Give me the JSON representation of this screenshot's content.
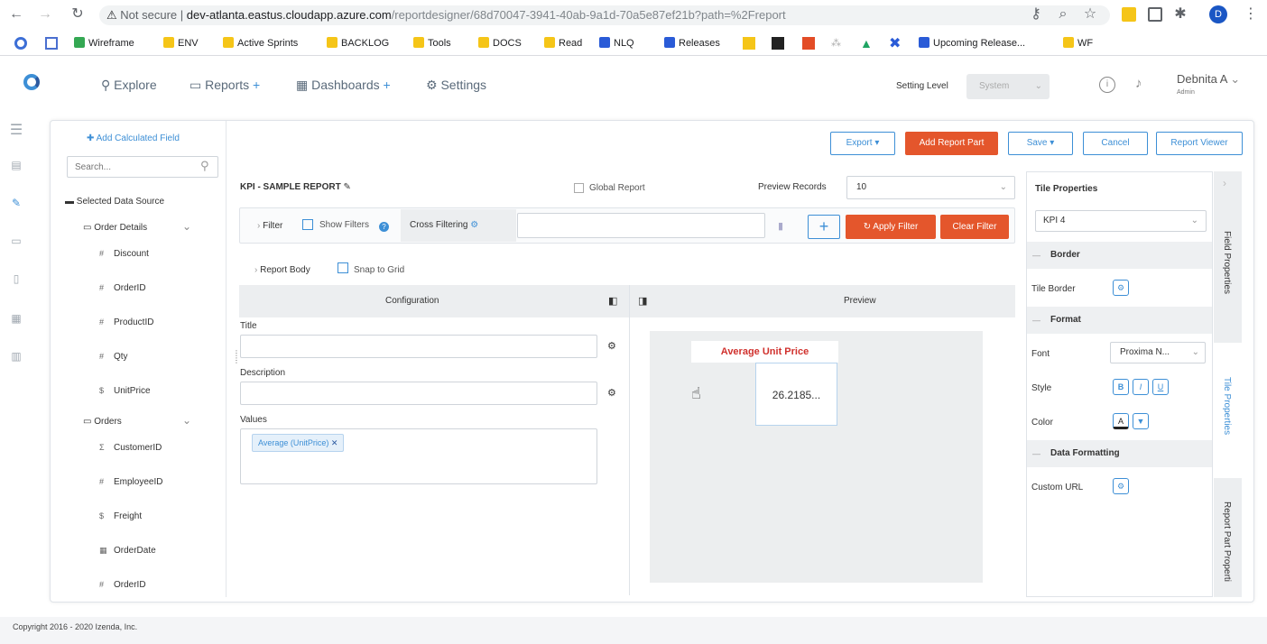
{
  "browser": {
    "not_secure": "Not secure",
    "url_host": "dev-atlanta.eastus.cloudapp.azure.com",
    "url_path": "/reportdesigner/68d70047-3941-40ab-9a1d-70a5e87ef21b?path=%2Freport",
    "profile_initial": "D",
    "bookmarks": [
      "Wireframe",
      "ENV",
      "Active Sprints",
      "BACKLOG",
      "Tools",
      "DOCS",
      "Read",
      "NLQ",
      "Releases",
      "Upcoming Release...",
      "WF"
    ]
  },
  "header": {
    "explore": "Explore",
    "reports": "Reports",
    "dashboards": "Dashboards",
    "settings": "Settings",
    "setting_level_label": "Setting Level",
    "setting_level_value": "System",
    "user_name": "Debnita A",
    "user_role": "Admin"
  },
  "toolbar": {
    "export": "Export",
    "add_report_part": "Add Report Part",
    "save": "Save",
    "cancel": "Cancel",
    "report_viewer": "Report Viewer"
  },
  "datasource": {
    "add_calculated_field": "Add Calculated Field",
    "search_placeholder": "Search...",
    "selected_label": "Selected Data Source",
    "groups": [
      {
        "name": "Order Details",
        "fields": [
          {
            "name": "Discount",
            "type": "#"
          },
          {
            "name": "OrderID",
            "type": "#"
          },
          {
            "name": "ProductID",
            "type": "#"
          },
          {
            "name": "Qty",
            "type": "#"
          },
          {
            "name": "UnitPrice",
            "type": "$"
          }
        ]
      },
      {
        "name": "Orders",
        "fields": [
          {
            "name": "CustomerID",
            "type": "Σ"
          },
          {
            "name": "EmployeeID",
            "type": "#"
          },
          {
            "name": "Freight",
            "type": "$"
          },
          {
            "name": "OrderDate",
            "type": "▦"
          },
          {
            "name": "OrderID",
            "type": "#"
          }
        ]
      }
    ]
  },
  "report": {
    "title": "KPI - SAMPLE REPORT",
    "global_report": "Global Report",
    "preview_records_label": "Preview Records",
    "preview_records_value": "10",
    "filter": "Filter",
    "show_filters": "Show Filters",
    "cross_filtering": "Cross Filtering",
    "apply_filter": "Apply Filter",
    "clear_filter": "Clear Filter",
    "report_body": "Report Body",
    "snap_to_grid": "Snap to Grid",
    "configuration": "Configuration",
    "preview": "Preview",
    "title_label": "Title",
    "description_label": "Description",
    "values_label": "Values",
    "value_chip": "Average (UnitPrice)"
  },
  "kpi_tile": {
    "title": "Average Unit Price",
    "value": "26.2185..."
  },
  "tile_properties": {
    "header": "Tile Properties",
    "selected": "KPI 4",
    "border_section": "Border",
    "tile_border": "Tile Border",
    "format_section": "Format",
    "font_label": "Font",
    "font_value": "Proxima N...",
    "style_label": "Style",
    "style_b": "B",
    "style_i": "I",
    "style_u": "U",
    "color_label": "Color",
    "color_a": "A",
    "data_formatting_section": "Data Formatting",
    "custom_url": "Custom URL",
    "tab_field": "Field Properties",
    "tab_tile": "Tile Properties",
    "tab_report_part": "Report Part Properti"
  },
  "footer": {
    "copyright": "Copyright 2016 - 2020 Izenda, Inc."
  },
  "colors": {
    "accent": "#3d8fd6",
    "orange": "#e4562c",
    "kpi_title": "#d0312d"
  }
}
